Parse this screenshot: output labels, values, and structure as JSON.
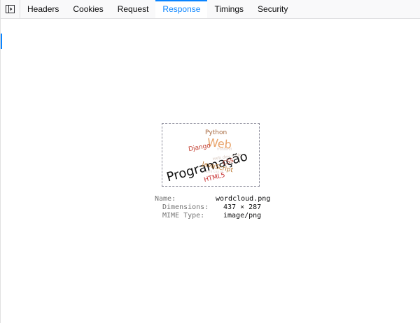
{
  "tabs": [
    {
      "label": "Headers",
      "selected": false
    },
    {
      "label": "Cookies",
      "selected": false
    },
    {
      "label": "Request",
      "selected": false
    },
    {
      "label": "Response",
      "selected": true
    },
    {
      "label": "Timings",
      "selected": false
    },
    {
      "label": "Security",
      "selected": false
    }
  ],
  "icons": {
    "sidebar_toggle": "sidebar-toggle-icon"
  },
  "colors": {
    "accent": "#0a84ff",
    "toolbar_bg": "#f9f9fa",
    "label_gray": "#737373"
  },
  "image_preview": {
    "words": [
      {
        "text": "Programação",
        "color": "#111111"
      },
      {
        "text": "Web",
        "color": "#e8a36a"
      },
      {
        "text": "Python",
        "color": "#a5663c"
      },
      {
        "text": "Django",
        "color": "#c0392b"
      },
      {
        "text": "CSS",
        "color": "#b03a2e"
      },
      {
        "text": "JavaScript",
        "color": "#b9772f"
      },
      {
        "text": "HTML5",
        "color": "#c62828"
      }
    ]
  },
  "image_info": {
    "name_label": "Name:",
    "name_value": "wordcloud.png",
    "dimensions_label": "Dimensions:",
    "dimensions_value": "437 × 287",
    "mime_label": "MIME Type:",
    "mime_value": "image/png"
  }
}
